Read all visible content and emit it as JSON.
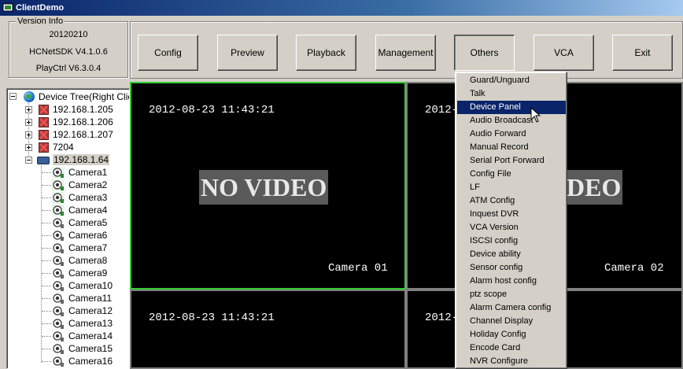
{
  "window": {
    "title": "ClientDemo"
  },
  "version_info": {
    "legend": "Version Info",
    "build": "20120210",
    "sdk": "HCNetSDK V4.1.0.6",
    "playctrl": "PlayCtrl V6.3.0.4"
  },
  "toolbar": {
    "buttons": [
      "Config",
      "Preview",
      "Playback",
      "Management",
      "Others",
      "VCA",
      "Exit"
    ]
  },
  "tree": {
    "root": "Device Tree(Right Click",
    "devices": [
      "192.168.1.205",
      "192.168.1.206",
      "192.168.1.207",
      "7204"
    ],
    "expanded_device": "192.168.1.64",
    "cameras": [
      "Camera1",
      "Camera2",
      "Camera3",
      "Camera4",
      "Camera5",
      "Camera6",
      "Camera7",
      "Camera8",
      "Camera9",
      "Camera10",
      "Camera11",
      "Camera12",
      "Camera13",
      "Camera14",
      "Camera15",
      "Camera16"
    ]
  },
  "video": {
    "cells": [
      {
        "timestamp": "2012-08-23 11:43:21",
        "overlay": "NO VIDEO",
        "camera": "Camera 01"
      },
      {
        "timestamp": "2012-",
        "overlay": "DEO",
        "camera": "Camera 02"
      },
      {
        "timestamp": "2012-08-23 11:43:21"
      },
      {
        "timestamp": "2012-"
      }
    ]
  },
  "others_menu": {
    "items": [
      "Guard/Unguard",
      "Talk",
      "Device Panel",
      "Audio Broadcast",
      "Audio Forward",
      "Manual Record",
      "Serial Port Forward",
      "Config File",
      "LF",
      "ATM Config",
      "Inquest DVR",
      "VCA Version",
      "ISCSI config",
      "Device ability",
      "Sensor config",
      "Alarm host config",
      "ptz scope",
      "Alarm Camera config",
      "Channel Display",
      "Holiday Config",
      "Encode Card",
      "NVR Configure"
    ],
    "highlighted": "Device Panel"
  },
  "colors": {
    "active_border": "#33cc33",
    "menu_highlight": "#0a246a",
    "titlebar": "#0a246a"
  }
}
